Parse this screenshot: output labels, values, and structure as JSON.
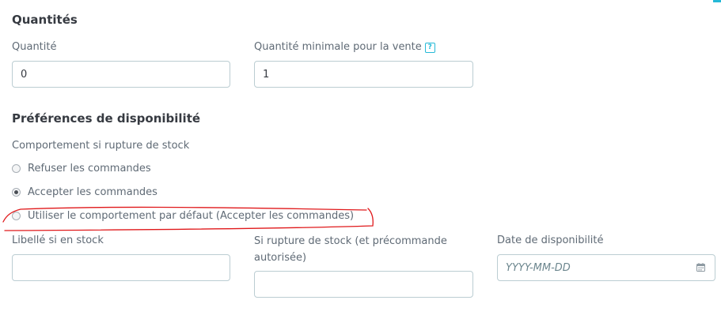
{
  "quantities": {
    "title": "Quantités",
    "quantity_label": "Quantité",
    "quantity_value": "0",
    "min_quantity_label": "Quantité minimale pour la vente",
    "min_quantity_help": "?",
    "min_quantity_value": "1"
  },
  "availability": {
    "title": "Préférences de disponibilité",
    "stock_behavior_label": "Comportement si rupture de stock",
    "options": [
      {
        "label": "Refuser les commandes",
        "checked": false
      },
      {
        "label": "Accepter les commandes",
        "checked": true
      },
      {
        "label": "Utiliser le comportement par défaut (Accepter les commandes)",
        "checked": false
      }
    ],
    "in_stock_label": "Libellé si en stock",
    "in_stock_value": "",
    "out_of_stock_label": "Si rupture de stock (et précommande autorisée)",
    "out_of_stock_value": "",
    "availability_date_label": "Date de disponibilité",
    "availability_date_placeholder": "YYYY-MM-DD"
  },
  "icons": {
    "help": "help-icon",
    "calendar": "calendar-icon"
  },
  "colors": {
    "accent": "#25b9d7",
    "annotation": "#e0191b",
    "input_border": "#bbcdd2"
  }
}
